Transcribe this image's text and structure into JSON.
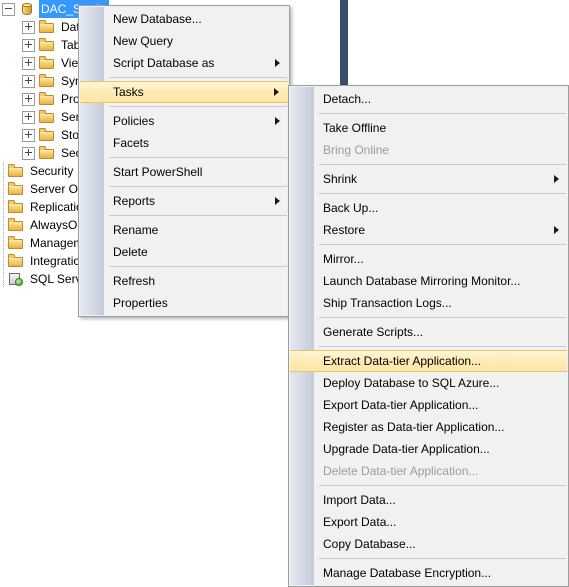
{
  "tree": {
    "name": "object-explorer",
    "nodes": [
      {
        "label": "DAC_Studio",
        "icon": "database-icon",
        "depth": 0,
        "expander": "minus",
        "selected": true
      },
      {
        "label": "Database Diagrams",
        "icon": "folder-icon",
        "depth": 1,
        "expander": "plus",
        "selected": false
      },
      {
        "label": "Tables",
        "icon": "folder-icon",
        "depth": 1,
        "expander": "plus",
        "selected": false
      },
      {
        "label": "Views",
        "icon": "folder-icon",
        "depth": 1,
        "expander": "plus",
        "selected": false
      },
      {
        "label": "Synonyms",
        "icon": "folder-icon",
        "depth": 1,
        "expander": "plus",
        "selected": false
      },
      {
        "label": "Programmability",
        "icon": "folder-icon",
        "depth": 1,
        "expander": "plus",
        "selected": false
      },
      {
        "label": "Service Broker",
        "icon": "folder-icon",
        "depth": 1,
        "expander": "plus",
        "selected": false
      },
      {
        "label": "Storage",
        "icon": "folder-icon",
        "depth": 1,
        "expander": "plus",
        "selected": false
      },
      {
        "label": "Security",
        "icon": "folder-icon",
        "depth": 1,
        "expander": "plus",
        "selected": false
      },
      {
        "label": "Security",
        "icon": "folder-icon",
        "depth": 0,
        "expander": "none",
        "selected": false
      },
      {
        "label": "Server Objects",
        "icon": "folder-icon",
        "depth": 0,
        "expander": "none",
        "selected": false
      },
      {
        "label": "Replication",
        "icon": "folder-icon",
        "depth": 0,
        "expander": "none",
        "selected": false
      },
      {
        "label": "AlwaysOn High Availability",
        "icon": "folder-icon",
        "depth": 0,
        "expander": "none",
        "selected": false
      },
      {
        "label": "Management",
        "icon": "folder-icon",
        "depth": 0,
        "expander": "none",
        "selected": false
      },
      {
        "label": "Integration Services Catalogs",
        "icon": "folder-icon",
        "depth": 0,
        "expander": "none",
        "selected": false
      },
      {
        "label": "SQL Server Agent",
        "icon": "sql-agent-icon",
        "depth": 0,
        "expander": "none",
        "selected": false
      }
    ]
  },
  "context_menu": {
    "name": "database-context-menu",
    "items": [
      {
        "label": "New Database...",
        "type": "item",
        "submenu": false,
        "disabled": false,
        "highlighted": false
      },
      {
        "label": "New Query",
        "type": "item",
        "submenu": false,
        "disabled": false,
        "highlighted": false
      },
      {
        "label": "Script Database as",
        "type": "item",
        "submenu": true,
        "disabled": false,
        "highlighted": false
      },
      {
        "label": "",
        "type": "separator"
      },
      {
        "label": "Tasks",
        "type": "item",
        "submenu": true,
        "disabled": false,
        "highlighted": true
      },
      {
        "label": "",
        "type": "separator"
      },
      {
        "label": "Policies",
        "type": "item",
        "submenu": true,
        "disabled": false,
        "highlighted": false
      },
      {
        "label": "Facets",
        "type": "item",
        "submenu": false,
        "disabled": false,
        "highlighted": false
      },
      {
        "label": "",
        "type": "separator"
      },
      {
        "label": "Start PowerShell",
        "type": "item",
        "submenu": false,
        "disabled": false,
        "highlighted": false
      },
      {
        "label": "",
        "type": "separator"
      },
      {
        "label": "Reports",
        "type": "item",
        "submenu": true,
        "disabled": false,
        "highlighted": false
      },
      {
        "label": "",
        "type": "separator"
      },
      {
        "label": "Rename",
        "type": "item",
        "submenu": false,
        "disabled": false,
        "highlighted": false
      },
      {
        "label": "Delete",
        "type": "item",
        "submenu": false,
        "disabled": false,
        "highlighted": false
      },
      {
        "label": "",
        "type": "separator"
      },
      {
        "label": "Refresh",
        "type": "item",
        "submenu": false,
        "disabled": false,
        "highlighted": false
      },
      {
        "label": "Properties",
        "type": "item",
        "submenu": false,
        "disabled": false,
        "highlighted": false
      }
    ]
  },
  "tasks_submenu": {
    "name": "tasks-submenu",
    "items": [
      {
        "label": "Detach...",
        "type": "item",
        "submenu": false,
        "disabled": false,
        "highlighted": false
      },
      {
        "label": "",
        "type": "separator"
      },
      {
        "label": "Take Offline",
        "type": "item",
        "submenu": false,
        "disabled": false,
        "highlighted": false
      },
      {
        "label": "Bring Online",
        "type": "item",
        "submenu": false,
        "disabled": true,
        "highlighted": false
      },
      {
        "label": "",
        "type": "separator"
      },
      {
        "label": "Shrink",
        "type": "item",
        "submenu": true,
        "disabled": false,
        "highlighted": false
      },
      {
        "label": "",
        "type": "separator"
      },
      {
        "label": "Back Up...",
        "type": "item",
        "submenu": false,
        "disabled": false,
        "highlighted": false
      },
      {
        "label": "Restore",
        "type": "item",
        "submenu": true,
        "disabled": false,
        "highlighted": false
      },
      {
        "label": "",
        "type": "separator"
      },
      {
        "label": "Mirror...",
        "type": "item",
        "submenu": false,
        "disabled": false,
        "highlighted": false
      },
      {
        "label": "Launch Database Mirroring Monitor...",
        "type": "item",
        "submenu": false,
        "disabled": false,
        "highlighted": false
      },
      {
        "label": "Ship Transaction Logs...",
        "type": "item",
        "submenu": false,
        "disabled": false,
        "highlighted": false
      },
      {
        "label": "",
        "type": "separator"
      },
      {
        "label": "Generate Scripts...",
        "type": "item",
        "submenu": false,
        "disabled": false,
        "highlighted": false
      },
      {
        "label": "",
        "type": "separator"
      },
      {
        "label": "Extract Data-tier Application...",
        "type": "item",
        "submenu": false,
        "disabled": false,
        "highlighted": true
      },
      {
        "label": "Deploy Database to SQL Azure...",
        "type": "item",
        "submenu": false,
        "disabled": false,
        "highlighted": false
      },
      {
        "label": "Export Data-tier Application...",
        "type": "item",
        "submenu": false,
        "disabled": false,
        "highlighted": false
      },
      {
        "label": "Register as Data-tier Application...",
        "type": "item",
        "submenu": false,
        "disabled": false,
        "highlighted": false
      },
      {
        "label": "Upgrade Data-tier Application...",
        "type": "item",
        "submenu": false,
        "disabled": false,
        "highlighted": false
      },
      {
        "label": "Delete Data-tier Application...",
        "type": "item",
        "submenu": false,
        "disabled": true,
        "highlighted": false
      },
      {
        "label": "",
        "type": "separator"
      },
      {
        "label": "Import Data...",
        "type": "item",
        "submenu": false,
        "disabled": false,
        "highlighted": false
      },
      {
        "label": "Export Data...",
        "type": "item",
        "submenu": false,
        "disabled": false,
        "highlighted": false
      },
      {
        "label": "Copy Database...",
        "type": "item",
        "submenu": false,
        "disabled": false,
        "highlighted": false
      },
      {
        "label": "",
        "type": "separator"
      },
      {
        "label": "Manage Database Encryption...",
        "type": "item",
        "submenu": false,
        "disabled": false,
        "highlighted": false
      }
    ]
  },
  "colors": {
    "selection_blue": "#3399ff",
    "highlight_gold": "#ffeab3",
    "highlight_border": "#e8c56a",
    "menu_background": "#f1f1f1",
    "gutter": "#ccd3e0",
    "splitter_navy": "#3b4d6b",
    "disabled_text": "#9c9c9c"
  }
}
